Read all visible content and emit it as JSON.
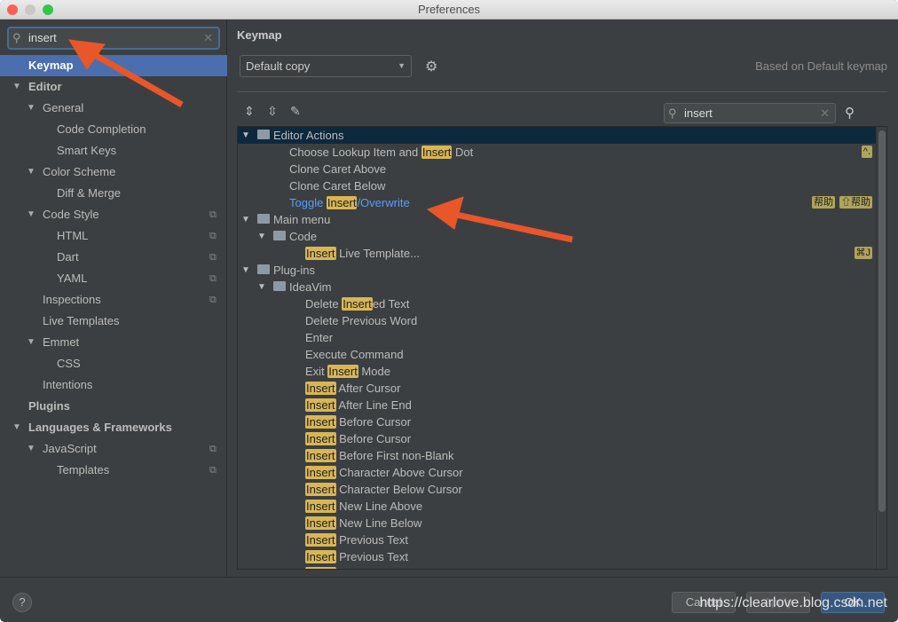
{
  "window": {
    "title": "Preferences"
  },
  "sidebar": {
    "search_value": "insert",
    "items": [
      {
        "label": "Keymap",
        "level": 0,
        "selected": true,
        "bold": true
      },
      {
        "label": "Editor",
        "level": 0,
        "expanded": true,
        "bold": true
      },
      {
        "label": "General",
        "level": 1,
        "expanded": true
      },
      {
        "label": "Code Completion",
        "level": 2
      },
      {
        "label": "Smart Keys",
        "level": 2
      },
      {
        "label": "Color Scheme",
        "level": 1,
        "expanded": true
      },
      {
        "label": "Diff & Merge",
        "level": 2
      },
      {
        "label": "Code Style",
        "level": 1,
        "expanded": true,
        "copy": true
      },
      {
        "label": "HTML",
        "level": 2,
        "copy": true
      },
      {
        "label": "Dart",
        "level": 2,
        "copy": true
      },
      {
        "label": "YAML",
        "level": 2,
        "copy": true
      },
      {
        "label": "Inspections",
        "level": 1,
        "copy": true
      },
      {
        "label": "Live Templates",
        "level": 1
      },
      {
        "label": "Emmet",
        "level": 1,
        "expanded": true
      },
      {
        "label": "CSS",
        "level": 2
      },
      {
        "label": "Intentions",
        "level": 1
      },
      {
        "label": "Plugins",
        "level": 0,
        "bold": true
      },
      {
        "label": "Languages & Frameworks",
        "level": 0,
        "expanded": true,
        "bold": true
      },
      {
        "label": "JavaScript",
        "level": 1,
        "expanded": true,
        "copy": true
      },
      {
        "label": "Templates",
        "level": 2,
        "copy": true
      }
    ]
  },
  "main": {
    "title": "Keymap",
    "keymap_select": "Default copy",
    "based_on": "Based on Default keymap",
    "filter_value": "insert",
    "tree": [
      {
        "level": 0,
        "node": true,
        "icon": "editor-actions-folder",
        "pre": "Editor Actions",
        "hl": "",
        "post": "",
        "selected": true
      },
      {
        "level": 1,
        "pre": "Choose Lookup Item and ",
        "hl": "Insert",
        "post": " Dot",
        "shortcuts": [
          "^."
        ]
      },
      {
        "level": 1,
        "pre": "Clone Caret Above",
        "hl": "",
        "post": ""
      },
      {
        "level": 1,
        "pre": "Clone Caret Below",
        "hl": "",
        "post": ""
      },
      {
        "level": 1,
        "pre": "Toggle ",
        "hl": "Insert",
        "post": "/Overwrite",
        "blue": true,
        "shortcuts": [
          "⇧帮助",
          "帮助"
        ]
      },
      {
        "level": 0,
        "node": true,
        "icon": "menu-folder",
        "pre": "Main menu",
        "hl": "",
        "post": ""
      },
      {
        "level": 1,
        "node": true,
        "icon": "folder",
        "pre": "Code",
        "hl": "",
        "post": ""
      },
      {
        "level": 2,
        "pre": "",
        "hl": "Insert",
        "post": " Live Template...",
        "shortcuts": [
          "⌘J"
        ]
      },
      {
        "level": 0,
        "node": true,
        "icon": "folder",
        "pre": "Plug-ins",
        "hl": "",
        "post": ""
      },
      {
        "level": 1,
        "node": true,
        "icon": "folder",
        "pre": "IdeaVim",
        "hl": "",
        "post": ""
      },
      {
        "level": 2,
        "pre": "Delete ",
        "hl": "Insert",
        "post": "ed Text"
      },
      {
        "level": 2,
        "pre": "Delete Previous Word",
        "hl": "",
        "post": ""
      },
      {
        "level": 2,
        "pre": "Enter",
        "hl": "",
        "post": ""
      },
      {
        "level": 2,
        "pre": "Execute Command",
        "hl": "",
        "post": ""
      },
      {
        "level": 2,
        "pre": "Exit ",
        "hl": "Insert",
        "post": " Mode"
      },
      {
        "level": 2,
        "pre": "",
        "hl": "Insert",
        "post": " After Cursor"
      },
      {
        "level": 2,
        "pre": "",
        "hl": "Insert",
        "post": " After Line End"
      },
      {
        "level": 2,
        "pre": "",
        "hl": "Insert",
        "post": " Before Cursor"
      },
      {
        "level": 2,
        "pre": "",
        "hl": "Insert",
        "post": " Before Cursor"
      },
      {
        "level": 2,
        "pre": "",
        "hl": "Insert",
        "post": " Before First non-Blank"
      },
      {
        "level": 2,
        "pre": "",
        "hl": "Insert",
        "post": " Character Above Cursor"
      },
      {
        "level": 2,
        "pre": "",
        "hl": "Insert",
        "post": " Character Below Cursor"
      },
      {
        "level": 2,
        "pre": "",
        "hl": "Insert",
        "post": " New Line Above"
      },
      {
        "level": 2,
        "pre": "",
        "hl": "Insert",
        "post": " New Line Below"
      },
      {
        "level": 2,
        "pre": "",
        "hl": "Insert",
        "post": " Previous Text"
      },
      {
        "level": 2,
        "pre": "",
        "hl": "Insert",
        "post": " Previous Text"
      },
      {
        "level": 2,
        "pre": "",
        "hl": "Insert",
        "post": " Register"
      }
    ]
  },
  "footer": {
    "help": "?",
    "cancel": "Cancel",
    "apply": "Apply",
    "ok": "OK",
    "watermark": "https://clearlove.blog.csdn.net"
  },
  "colors": {
    "selection": "#4b6eaf",
    "highlight": "#d8b655",
    "link": "#589df6",
    "annotation_arrow": "#e8562a"
  }
}
